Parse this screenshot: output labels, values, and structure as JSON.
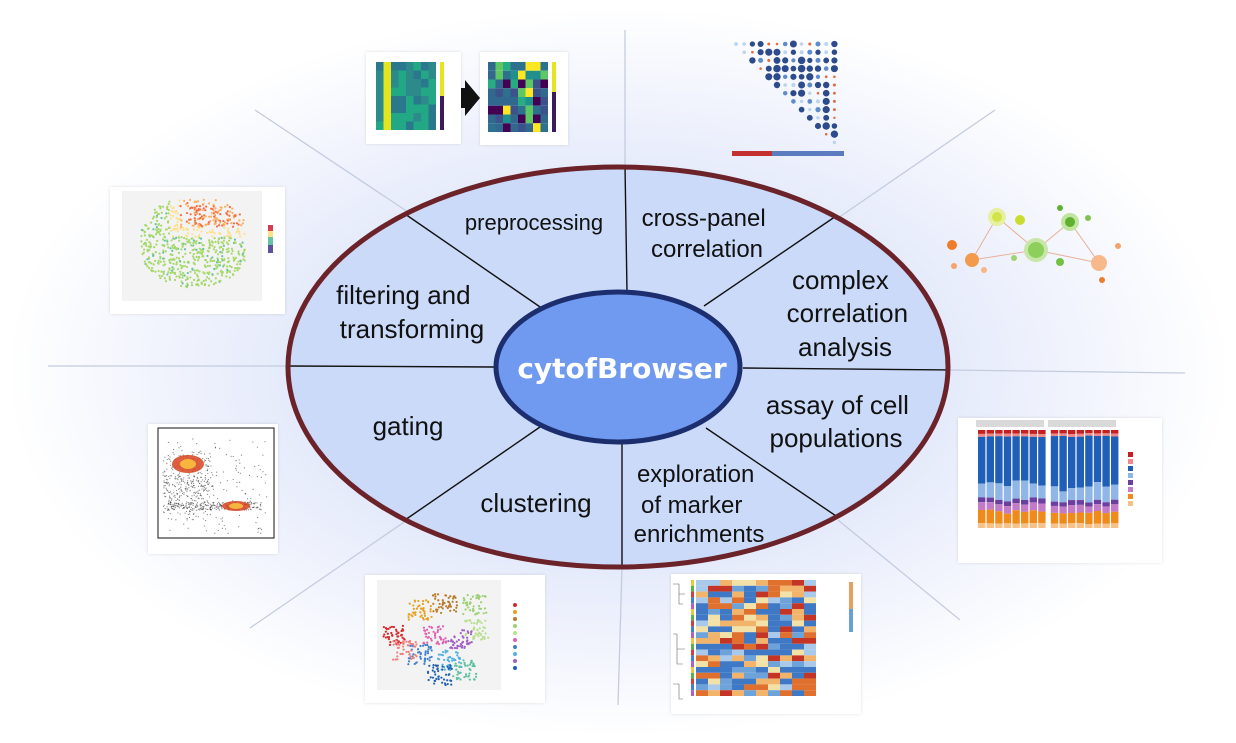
{
  "diagram": {
    "center": {
      "label": "cytofBrowser"
    },
    "segments": [
      {
        "id": "preprocessing",
        "lines": [
          "preprocessing"
        ]
      },
      {
        "id": "cross-panel",
        "lines": [
          "cross-panel",
          "correlation"
        ]
      },
      {
        "id": "complex-correlation",
        "lines": [
          "complex",
          "correlation",
          "analysis"
        ]
      },
      {
        "id": "assay",
        "lines": [
          "assay of cell",
          "populations"
        ]
      },
      {
        "id": "exploration",
        "lines": [
          "exploration",
          "of marker",
          "enrichments"
        ]
      },
      {
        "id": "clustering",
        "lines": [
          "clustering"
        ]
      },
      {
        "id": "gating",
        "lines": [
          "gating"
        ]
      },
      {
        "id": "filtering",
        "lines": [
          "filtering and",
          "transforming"
        ]
      }
    ],
    "colors": {
      "outer_ring": "#6b2228",
      "segment_fill": "#cadaf8",
      "center_fill": "#7099f0",
      "center_stroke": "#1c2e6e",
      "divider": "#111111"
    }
  },
  "thumbnails": [
    {
      "name": "preprocessing-heatmap-before-thumbnail"
    },
    {
      "name": "preprocessing-heatmap-after-thumbnail"
    },
    {
      "name": "correlation-matrix-thumbnail"
    },
    {
      "name": "network-graph-thumbnail"
    },
    {
      "name": "stacked-bar-proportion-thumbnail"
    },
    {
      "name": "marker-enrichment-heatmap-thumbnail"
    },
    {
      "name": "tsne-clustering-thumbnail"
    },
    {
      "name": "gating-density-thumbnail"
    },
    {
      "name": "tsne-expression-thumbnail"
    }
  ]
}
